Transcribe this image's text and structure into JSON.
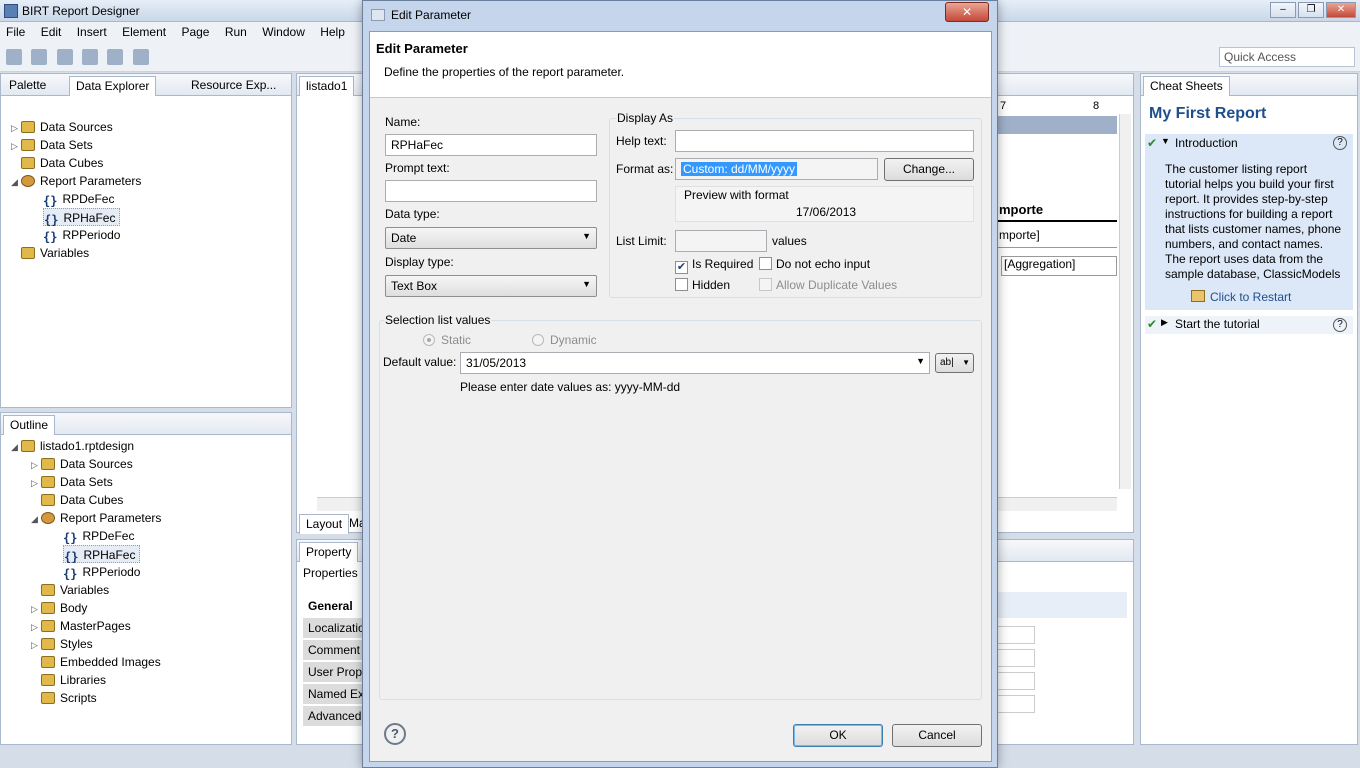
{
  "app": {
    "title": "BIRT Report Designer",
    "menu": [
      "File",
      "Edit",
      "Insert",
      "Element",
      "Page",
      "Run",
      "Window",
      "Help"
    ],
    "quick_access": "Quick Access",
    "window_buttons": {
      "minimize": "–",
      "restore": "❐",
      "close": "✕"
    }
  },
  "left_top": {
    "tabs": [
      "Palette",
      "Data Explorer",
      "Resource Exp..."
    ],
    "tree": [
      {
        "label": "Data Sources",
        "expander": "▷"
      },
      {
        "label": "Data Sets",
        "expander": "▷"
      },
      {
        "label": "Data Cubes",
        "expander": ""
      },
      {
        "label": "Report Parameters",
        "expander": "◢"
      },
      {
        "label": "RPDeFec"
      },
      {
        "label": "RPHaFec"
      },
      {
        "label": "RPPeriodo"
      },
      {
        "label": "Variables"
      }
    ]
  },
  "outline": {
    "tab": "Outline",
    "tree": [
      {
        "label": "listado1.rptdesign"
      },
      {
        "label": "Data Sources"
      },
      {
        "label": "Data Sets"
      },
      {
        "label": "Data Cubes"
      },
      {
        "label": "Report Parameters"
      },
      {
        "label": "RPDeFec"
      },
      {
        "label": "RPHaFec"
      },
      {
        "label": "RPPeriodo"
      },
      {
        "label": "Variables"
      },
      {
        "label": "Body"
      },
      {
        "label": "MasterPages"
      },
      {
        "label": "Styles"
      },
      {
        "label": "Embedded Images"
      },
      {
        "label": "Libraries"
      },
      {
        "label": "Scripts"
      }
    ]
  },
  "editor": {
    "tab": "listado1",
    "ruler_marks": [
      "7",
      "8"
    ],
    "cells": [
      "mporte",
      "mporte]",
      "[Aggregation]"
    ],
    "bottom_tabs": [
      "Layout",
      "Ma"
    ]
  },
  "properties": {
    "tab": "Property",
    "subtab": "Properties",
    "categories": [
      "General",
      "Localizatio",
      "Comment",
      "User Prop",
      "Named Ex",
      "Advanced"
    ]
  },
  "cheat_sheets": {
    "tab": "Cheat Sheets",
    "title": "My First Report",
    "intro_label": "Introduction",
    "intro_text": "The customer listing report tutorial helps you build your first report. It provides step-by-step instructions for building a report that lists customer names, phone numbers, and contact names. The report uses data from the sample database, ClassicModels",
    "restart": "Click to Restart",
    "start": "Start the tutorial",
    "help": "?"
  },
  "dialog": {
    "window_title": "Edit Parameter",
    "heading": "Edit Parameter",
    "description": "Define the properties of the report parameter.",
    "name_label": "Name:",
    "name_value": "RPHaFec",
    "prompt_label": "Prompt text:",
    "prompt_value": "",
    "data_type_label": "Data type:",
    "data_type_value": "Date",
    "display_type_label": "Display type:",
    "display_type_value": "Text Box",
    "display_as_label": "Display As",
    "help_text_label": "Help text:",
    "help_text_value": "",
    "format_as_label": "Format as:",
    "format_as_value": "Custom: dd/MM/yyyy",
    "change_button": "Change...",
    "preview_label": "Preview with format",
    "preview_value": "17/06/2013",
    "list_limit_label": "List Limit:",
    "list_limit_value": "",
    "values_label": "values",
    "is_required": "Is Required",
    "do_not_echo": "Do not echo input",
    "hidden": "Hidden",
    "allow_duplicates": "Allow Duplicate Values",
    "selection_label": "Selection list values",
    "static_label": "Static",
    "dynamic_label": "Dynamic",
    "default_label": "Default value:",
    "default_value": "31/05/2013",
    "expr_button": "ab|",
    "hint": "Please enter date values as: yyyy-MM-dd",
    "ok": "OK",
    "cancel": "Cancel",
    "help_icon": "?",
    "close_glyph": "✕"
  }
}
